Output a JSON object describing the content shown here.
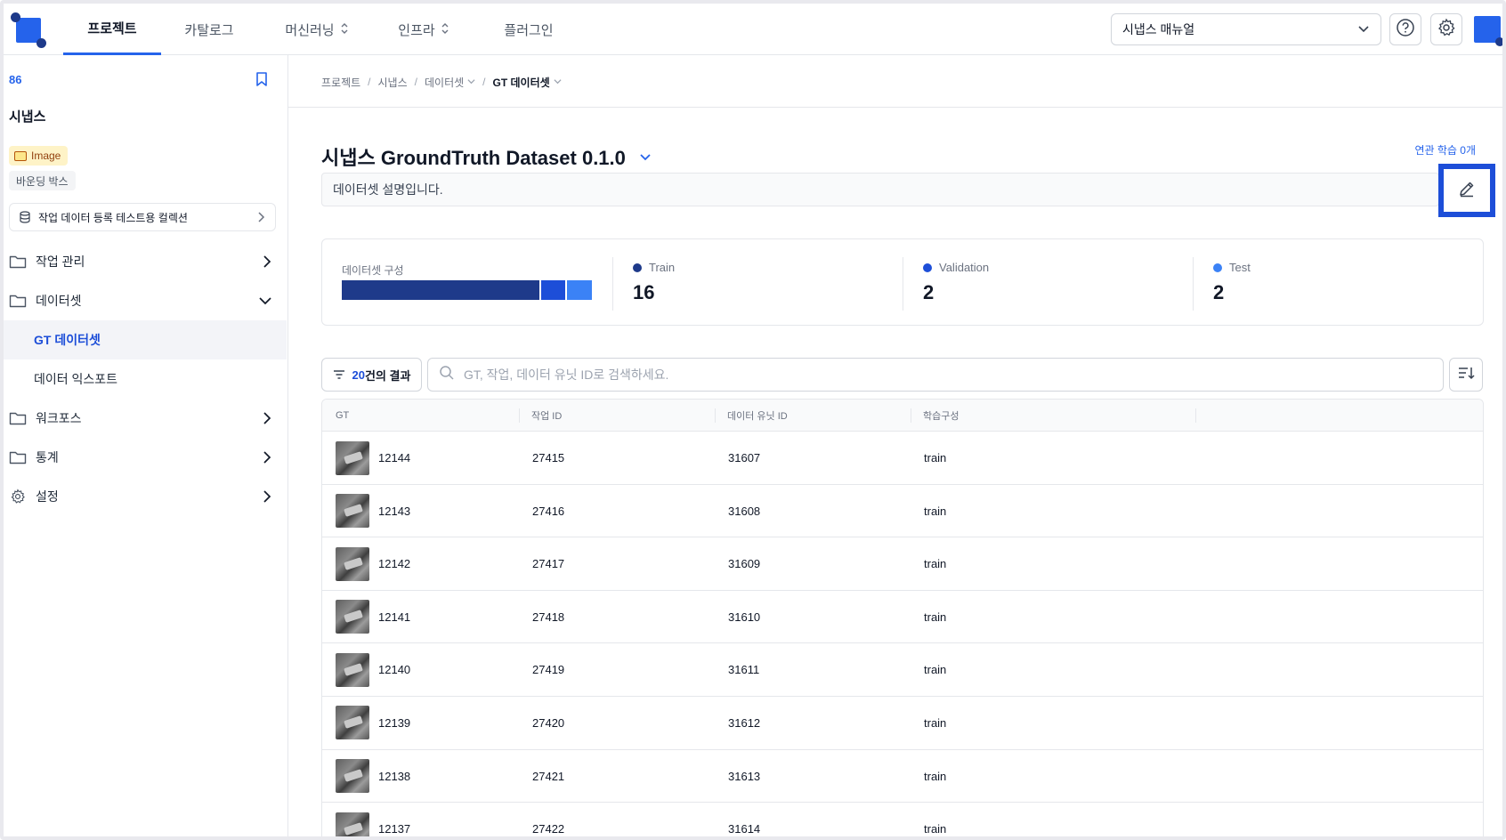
{
  "nav": {
    "tabs": [
      {
        "label": "프로젝트",
        "active": true,
        "has_dropdown": false
      },
      {
        "label": "카탈로그",
        "active": false,
        "has_dropdown": false
      },
      {
        "label": "머신러닝",
        "active": false,
        "has_dropdown": true
      },
      {
        "label": "인프라",
        "active": false,
        "has_dropdown": true
      },
      {
        "label": "플러그인",
        "active": false,
        "has_dropdown": false
      }
    ],
    "manual_select": "시냅스 매뉴얼",
    "icons": [
      "help-icon",
      "settings-icon"
    ]
  },
  "sidebar": {
    "project_id": "86",
    "project_name": "시냅스",
    "tags": {
      "image": "Image",
      "bbox": "바운딩 박스"
    },
    "collection": "작업 데이터 등록 테스트용 컬렉션",
    "menu": {
      "work": "작업 관리",
      "dataset": "데이터셋",
      "gt_dataset": "GT 데이터셋",
      "data_export": "데이터 익스포트",
      "workforce": "워크포스",
      "stats": "통계",
      "settings": "설정"
    }
  },
  "breadcrumb": [
    "프로젝트",
    "시냅스",
    "데이터셋",
    "GT 데이터셋"
  ],
  "dataset": {
    "title": "시냅스 GroundTruth Dataset 0.1.0",
    "linked_training": "연관 학습 0개",
    "description": "데이터셋 설명입니다."
  },
  "composition": {
    "label": "데이터셋 구성",
    "train": {
      "name": "Train",
      "count": "16",
      "color": "#1e3a8a"
    },
    "validation": {
      "name": "Validation",
      "count": "2",
      "color": "#1d4ed8"
    },
    "test": {
      "name": "Test",
      "count": "2",
      "color": "#3b82f6"
    }
  },
  "toolbar": {
    "result_count": "20",
    "result_suffix": "건의 결과",
    "search_placeholder": "GT, 작업, 데이터 유닛 ID로 검색하세요."
  },
  "table": {
    "columns": [
      "GT",
      "작업 ID",
      "데이터 유닛 ID",
      "학습구성"
    ],
    "rows": [
      {
        "gt": "12144",
        "task": "27415",
        "unit": "31607",
        "split": "train"
      },
      {
        "gt": "12143",
        "task": "27416",
        "unit": "31608",
        "split": "train"
      },
      {
        "gt": "12142",
        "task": "27417",
        "unit": "31609",
        "split": "train"
      },
      {
        "gt": "12141",
        "task": "27418",
        "unit": "31610",
        "split": "train"
      },
      {
        "gt": "12140",
        "task": "27419",
        "unit": "31611",
        "split": "train"
      },
      {
        "gt": "12139",
        "task": "27420",
        "unit": "31612",
        "split": "train"
      },
      {
        "gt": "12138",
        "task": "27421",
        "unit": "31613",
        "split": "train"
      },
      {
        "gt": "12137",
        "task": "27422",
        "unit": "31614",
        "split": "train"
      }
    ]
  }
}
